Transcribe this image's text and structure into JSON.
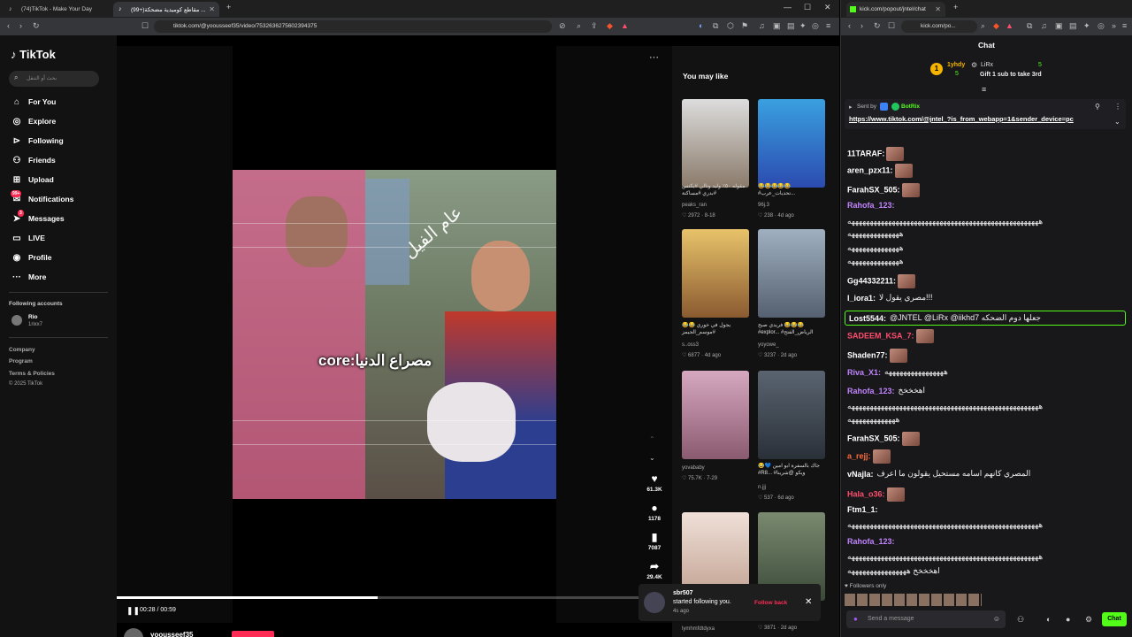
{
  "left_browser": {
    "tabs": [
      {
        "label": "(74)TikTok - Make Your Day",
        "active": false
      },
      {
        "label": "(99+)مقاطع كوميدية مضحكة ...",
        "active": true
      }
    ],
    "url": "tiktok.com/@yoousseef35/video/7532636275602394375",
    "window_controls": [
      "—",
      "☐",
      "✕"
    ]
  },
  "tiktok": {
    "logo": "TikTok",
    "search_placeholder": "بحث أو التنقل",
    "nav": [
      {
        "label": "For You",
        "icon": "home-icon"
      },
      {
        "label": "Explore",
        "icon": "compass-icon"
      },
      {
        "label": "Following",
        "icon": "following-icon"
      },
      {
        "label": "Friends",
        "icon": "friends-icon"
      },
      {
        "label": "Upload",
        "icon": "upload-icon"
      },
      {
        "label": "Notifications",
        "icon": "bell-icon",
        "badge": "99+"
      },
      {
        "label": "Messages",
        "icon": "send-icon",
        "badge": "3"
      },
      {
        "label": "LIVE",
        "icon": "live-icon"
      },
      {
        "label": "Profile",
        "icon": "profile-icon"
      },
      {
        "label": "More",
        "icon": "more-icon"
      }
    ],
    "following_accounts_title": "Following accounts",
    "following_account": {
      "name": "Rio",
      "handle": "1rixx7"
    },
    "footer_links": [
      "Company",
      "Program",
      "Terms & Policies"
    ],
    "copyright": "© 2025 TikTok",
    "video": {
      "caption_core": "core:مصراع الدنيا",
      "overlay_text": "عام الفيل",
      "time": "00:28 / 00:59",
      "progress": 0.47,
      "author": "yoousseef35"
    },
    "actions": [
      {
        "icon": "heart-icon",
        "count": "61.3K"
      },
      {
        "icon": "comment-icon",
        "count": "1178"
      },
      {
        "icon": "bookmark-icon",
        "count": "7087"
      },
      {
        "icon": "share-icon",
        "count": "29.4K"
      }
    ],
    "you_may_like": "You may like",
    "recommendations": [
      {
        "caption": "مقوله ٥٠٪ وليد وتالي #يكتس #بدري #مساكنة",
        "user": "peaks_ran",
        "likes": "2972",
        "date": "8-18"
      },
      {
        "caption": "😂😂😂😂😂 #تحديات_عرب...",
        "user": "96j.3",
        "likes": "238",
        "date": "4d ago"
      },
      {
        "caption": "😂😂 يجول في خوري #موسم_الجيمز",
        "user": "s..oss3",
        "likes": "6877",
        "date": "4d ago"
      },
      {
        "caption": "فريدي صبح 😂😂😂 #explor... #الرياض_الفتح",
        "user": "yoyowe_",
        "likes": "3237",
        "date": "2d ago"
      },
      {
        "caption": "",
        "user": "yovababy",
        "likes": "75.7K",
        "date": "7-29"
      },
      {
        "caption": "😂💙 جاك بالسفرة ابو امين #R8... #ويكو @شرينا",
        "user": "n.jjj",
        "likes": "537",
        "date": "6d ago"
      },
      {
        "caption": "",
        "user": "lymhmfdtdyxa",
        "likes": "",
        "date": ""
      },
      {
        "caption": "",
        "user": "",
        "likes": "3871",
        "date": "2d ago"
      }
    ],
    "notification": {
      "user": "sbr507",
      "text": "started following you.",
      "time": "4s ago",
      "action": "Follow back"
    }
  },
  "right_browser": {
    "tab_label": "kick.com/popout/jntel/chat",
    "url": "kick.com/po...",
    "chat_title": "Chat",
    "leaderboard": {
      "rank": "1",
      "user1": "1yhdy",
      "user1_count": "5",
      "user2": "LiRx",
      "user2_count": "5",
      "gift_text": "Gift 1 sub to take 3rd"
    },
    "pinned": {
      "sent_by": "Sent by",
      "sender": "BotRix",
      "link": "https://www.tiktok.com/@jntel_?is_from_webapp=1&sender_device=pc"
    },
    "messages": [
      {
        "user": "11TARAF:",
        "color": "#ffffff",
        "text": ""
      },
      {
        "user": "aren_pzx11:",
        "color": "#ffffff",
        "text": ""
      },
      {
        "user": "FarahSX_505:",
        "color": "#ffffff",
        "text": ""
      },
      {
        "user": "Rahofa_123:",
        "color": "#c084fc",
        "text": ""
      },
      {
        "user": "",
        "color": "#ffffff",
        "text": "ههههههههههههههههههههههههههههههههههههههههههههههههههههه"
      },
      {
        "user": "",
        "color": "#ffffff",
        "text": "ههههههههههههههه"
      },
      {
        "user": "",
        "color": "#ffffff",
        "text": "ههههههههههههههه"
      },
      {
        "user": "",
        "color": "#ffffff",
        "text": "ههههههههههههههه"
      },
      {
        "user": "Gg44332211:",
        "color": "#ffffff",
        "text": ""
      },
      {
        "user": "l_iora1:",
        "color": "#ffffff",
        "text": "مصري يقول لا!!!"
      },
      {
        "user": "Lost5544:",
        "color": "#ffffff",
        "text": "@JNTEL @LiRx @iikhd7 جعلها دوم الضحكه"
      },
      {
        "user": "SADEEM_KSA_7:",
        "color": "#ff4d6d",
        "text": ""
      },
      {
        "user": "Shaden77:",
        "color": "#ffffff",
        "text": ""
      },
      {
        "user": "Riva_X1:",
        "color": "#c084fc",
        "text": "ههههههههههههههههه"
      },
      {
        "user": "Rahofa_123:",
        "color": "#c084fc",
        "text": "اهخخخخ"
      },
      {
        "user": "",
        "color": "#ffffff",
        "text": "ههههههههههههههههههههههههههههههههههههههههههههههههههههه"
      },
      {
        "user": "",
        "color": "#ffffff",
        "text": "هههههههههههههه"
      },
      {
        "user": "FarahSX_505:",
        "color": "#ffffff",
        "text": ""
      },
      {
        "user": "a_rejj:",
        "color": "#ff6b3d",
        "text": ""
      },
      {
        "user": "vNajla:",
        "color": "#ffffff",
        "text": "المصري كانهم اسامه مستحيل يقولون ما اعرف"
      },
      {
        "user": "Hala_o36:",
        "color": "#ff4d6d",
        "text": ""
      },
      {
        "user": "Ftm1_1:",
        "color": "#ffffff",
        "text": ""
      },
      {
        "user": "",
        "color": "#ffffff",
        "text": "ههههههههههههههههههههههههههههههههههههههههههههههههههههه"
      },
      {
        "user": "Rahofa_123:",
        "color": "#c084fc",
        "text": ""
      },
      {
        "user": "",
        "color": "#ffffff",
        "text": "ههههههههههههههههههههههههههههههههههههههههههههههههههههه"
      },
      {
        "user": "",
        "color": "#ffffff",
        "text": "اهخخخخ ههههههههههههههههه"
      }
    ],
    "followers_only": "Followers only",
    "input_placeholder": "Send a message",
    "send_label": "Chat"
  }
}
